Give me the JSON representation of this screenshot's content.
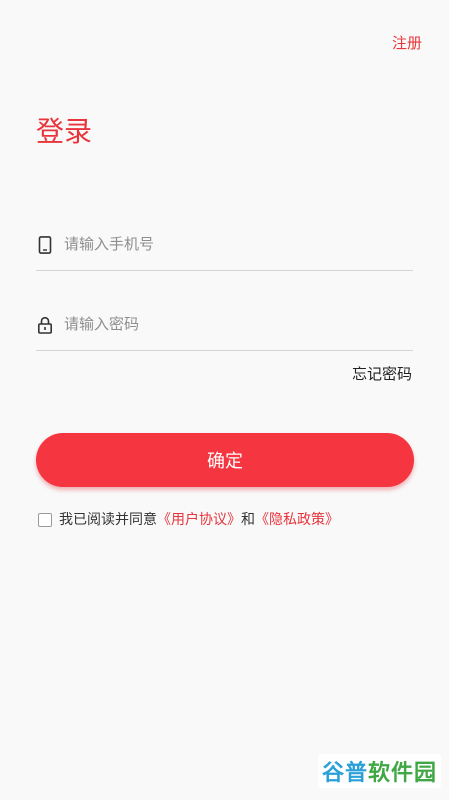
{
  "header": {
    "register_label": "注册"
  },
  "title": "登录",
  "form": {
    "phone": {
      "placeholder": "请输入手机号",
      "icon": "phone-icon"
    },
    "password": {
      "placeholder": "请输入密码",
      "icon": "lock-icon"
    },
    "forgot_label": "忘记密码",
    "confirm_label": "确定"
  },
  "agreement": {
    "checked": false,
    "prefix": "我已阅读并同意",
    "user_agreement": "《用户协议》",
    "conjunction": "和",
    "privacy_policy": "《隐私政策》"
  },
  "watermark": {
    "part1": "谷普",
    "part2": "软件园"
  },
  "colors": {
    "accent": "#e8353c",
    "button": "#f5353f",
    "background": "#f9f9f9"
  }
}
